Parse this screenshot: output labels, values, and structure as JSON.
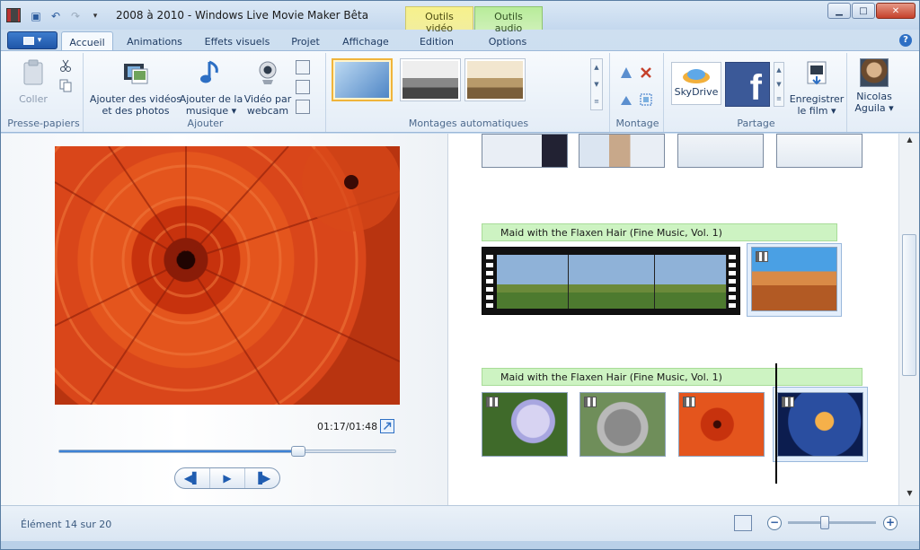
{
  "window": {
    "title": "2008 à 2010 - Windows Live Movie Maker Bêta",
    "context_tab_video": "Outils vidéo",
    "context_tab_audio": "Outils audio"
  },
  "ribbon_tabs": [
    {
      "label": "Accueil",
      "active": true
    },
    {
      "label": "Animations"
    },
    {
      "label": "Effets visuels"
    },
    {
      "label": "Projet"
    },
    {
      "label": "Affichage"
    },
    {
      "label": "Edition"
    },
    {
      "label": "Options"
    }
  ],
  "ribbon": {
    "clipboard": {
      "group": "Presse-papiers",
      "paste": "Coller"
    },
    "add": {
      "group": "Ajouter",
      "add_videos": "Ajouter des vidéos\net des photos",
      "add_music": "Ajouter de la\nmusique ▾",
      "webcam": "Vidéo par\nwebcam"
    },
    "automovie": {
      "group": "Montages automatiques"
    },
    "edit": {
      "group": "Montage"
    },
    "share": {
      "group": "Partage",
      "skydrive": "SkyDrive",
      "save_movie": "Enregistrer\nle film ▾",
      "user": "Nicolas\nAguila ▾"
    }
  },
  "preview": {
    "time": "01:17/01:48",
    "progress": 0.71
  },
  "storyboard": {
    "music_tracks": [
      "Maid with the Flaxen Hair (Fine Music, Vol. 1)",
      "Maid with the Flaxen Hair (Fine Music, Vol. 1)"
    ]
  },
  "status": {
    "item_counter": "Élément 14 sur 20",
    "zoom_level": 0.42
  },
  "colors": {
    "accent": "#2d6fc4",
    "music_bar": "#cdf3c2",
    "video_tools": "#f6f18c",
    "audio_tools": "#b8ec9a"
  }
}
